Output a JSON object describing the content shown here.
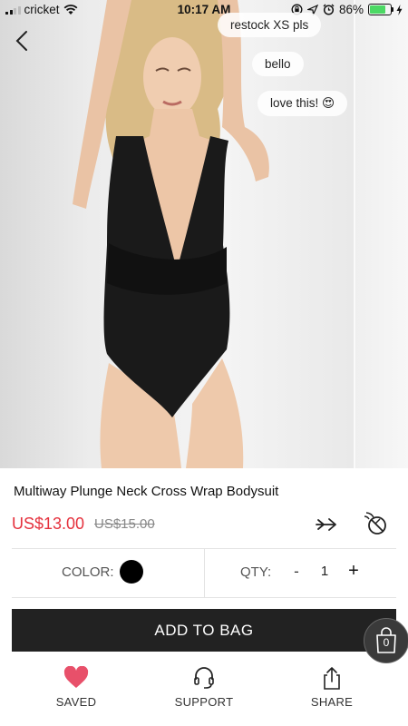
{
  "status_bar": {
    "carrier": "cricket",
    "time": "10:17 AM",
    "battery_percent": "86%",
    "battery_level": 0.86,
    "icons": [
      "signal-icon",
      "wifi-icon",
      "lock-rotation-icon",
      "location-arrow-icon",
      "alarm-icon",
      "battery-icon",
      "charging-icon"
    ]
  },
  "chat_bubbles": [
    {
      "text": "restock XS pls"
    },
    {
      "text": "bello"
    },
    {
      "text": "love this! 😍"
    }
  ],
  "product": {
    "title": "Multiway Plunge Neck Cross Wrap Bodysuit",
    "price": "US$13.00",
    "original_price": "US$15.00",
    "color_label": "COLOR:",
    "selected_color": "#000000",
    "qty_label": "QTY:",
    "qty_minus": "-",
    "qty_value": "1",
    "qty_plus": "+"
  },
  "actions": {
    "add_to_bag": "ADD TO BAG",
    "bag_count": "0"
  },
  "tab_bar": {
    "saved": "SAVED",
    "support": "SUPPORT",
    "share": "SHARE"
  },
  "colors": {
    "price_red": "#e5313d",
    "saved_heart": "#e8506a",
    "primary_button": "#222222"
  }
}
